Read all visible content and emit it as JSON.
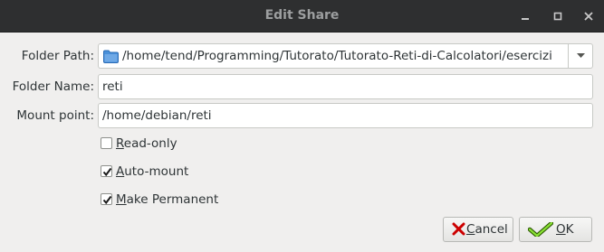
{
  "window": {
    "title": "Edit Share",
    "controls": [
      "minimize-icon",
      "maximize-icon",
      "close-icon"
    ]
  },
  "form": {
    "folder_path": {
      "label": "Folder Path:",
      "value": "/home/tend/Programming/Tutorato/Tutorato-Reti-di-Calcolatori/esercizi",
      "icon": "folder-icon"
    },
    "folder_name": {
      "label": "Folder Name:",
      "value": "reti"
    },
    "mount_point": {
      "label": "Mount point:",
      "value": "/home/debian/reti"
    },
    "options": [
      {
        "mnemonic": "R",
        "rest": "ead-only",
        "checked": false
      },
      {
        "mnemonic": "A",
        "rest": "uto-mount",
        "checked": true
      },
      {
        "mnemonic": "M",
        "rest": "ake Permanent",
        "checked": true
      }
    ]
  },
  "buttons": {
    "cancel": {
      "mnemonic": "C",
      "rest": "ancel",
      "icon": "cancel-x-icon"
    },
    "ok": {
      "mnemonic": "O",
      "rest": "K",
      "icon": "ok-check-icon"
    }
  },
  "colors": {
    "titlebar": "#2e2f30",
    "dialog_bg": "#f0efee",
    "folder_icon": "#4a90d9",
    "cancel_icon": "#cc0000",
    "ok_icon": "#4e9a06"
  }
}
